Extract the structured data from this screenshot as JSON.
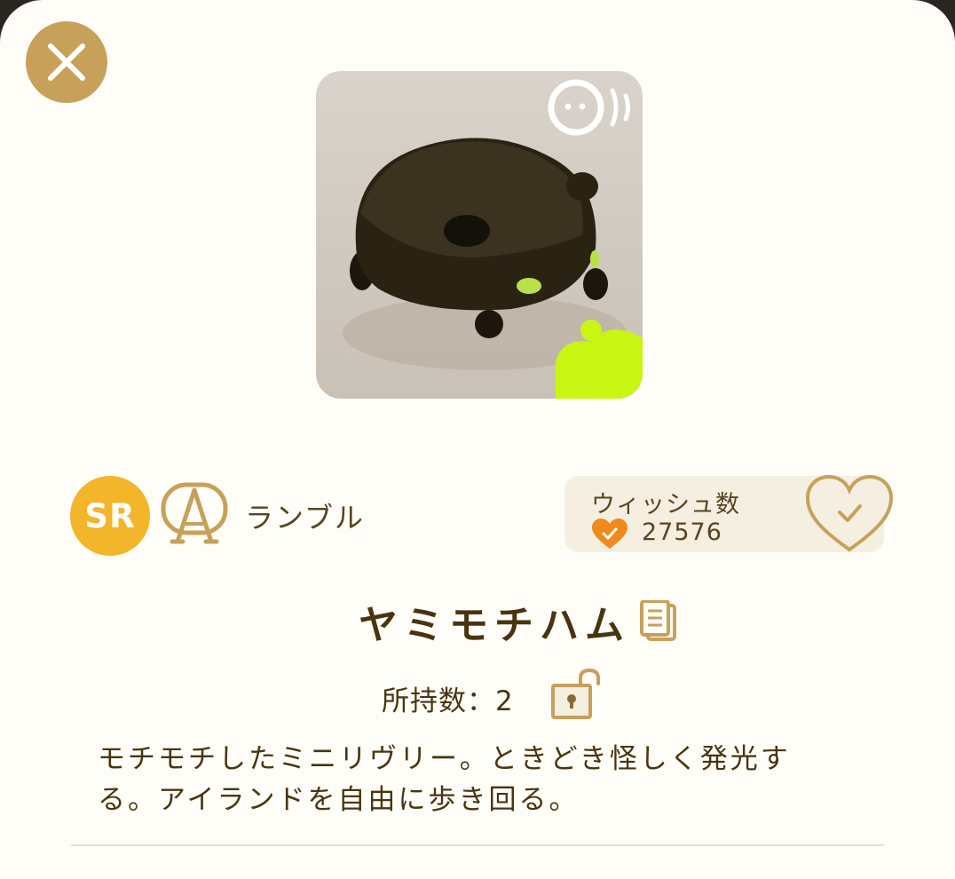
{
  "character": {
    "rarity": "SR",
    "type_name": "ランブル",
    "name": "ヤミモチハム",
    "owned_label": "所持数：2",
    "description": "モチモチしたミニリヴリー。ときどき怪しく発光する。アイランドを自由に歩き回る。"
  },
  "wish": {
    "label": "ウィッシュ数",
    "count": "27576"
  },
  "colors": {
    "accent_gold": "#c7a15a",
    "rarity_yellow": "#f3b52a",
    "wish_orange": "#f08a1c",
    "text_brown": "#4a3410"
  },
  "icons": {
    "close": "close-icon",
    "voice": "voice-icon",
    "type": "rumble-type-icon",
    "wish_small": "heart-check-icon",
    "wish_button": "heart-check-icon",
    "copy": "copy-icon",
    "lock": "unlock-icon"
  }
}
